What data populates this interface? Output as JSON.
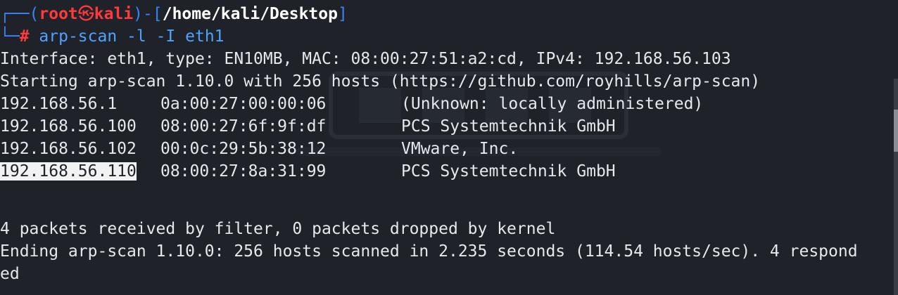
{
  "prompt": {
    "frame_open": "┌──(",
    "user": "root",
    "skull": "㉿",
    "host": "kali",
    "frame_mid": ")-[",
    "path": "/home/kali/Desktop",
    "frame_close": "]",
    "frame_bottom": "└─",
    "hash": "#",
    "command": "arp-scan -l -I eth1"
  },
  "output": {
    "interface_line": "Interface: eth1, type: EN10MB, MAC: 08:00:27:51:a2:cd, IPv4: 192.168.56.103",
    "start_line": "Starting arp-scan 1.10.0 with 256 hosts (https://github.com/royhills/arp-scan)",
    "hosts": [
      {
        "ip": "192.168.56.1",
        "mac": "0a:00:27:00:00:06",
        "vendor": "(Unknown: locally administered)"
      },
      {
        "ip": "192.168.56.100",
        "mac": "08:00:27:6f:9f:df",
        "vendor": "PCS Systemtechnik GmbH"
      },
      {
        "ip": "192.168.56.102",
        "mac": "00:0c:29:5b:38:12",
        "vendor": "VMware, Inc."
      },
      {
        "ip": "192.168.56.110",
        "mac": "08:00:27:8a:31:99",
        "vendor": "PCS Systemtechnik GmbH"
      }
    ],
    "packets_line": "4 packets received by filter, 0 packets dropped by kernel",
    "ending_line": "Ending arp-scan 1.10.0: 256 hosts scanned in 2.235 seconds (114.54 hosts/sec). 4 respond",
    "ending_wrap": "ed"
  },
  "colors": {
    "background": "#1f2229",
    "text": "#e6e8ee",
    "frame": "#3b82f6",
    "root": "#ff3a3a",
    "command": "#4fa3ff",
    "selection": "#f2f2f2"
  }
}
